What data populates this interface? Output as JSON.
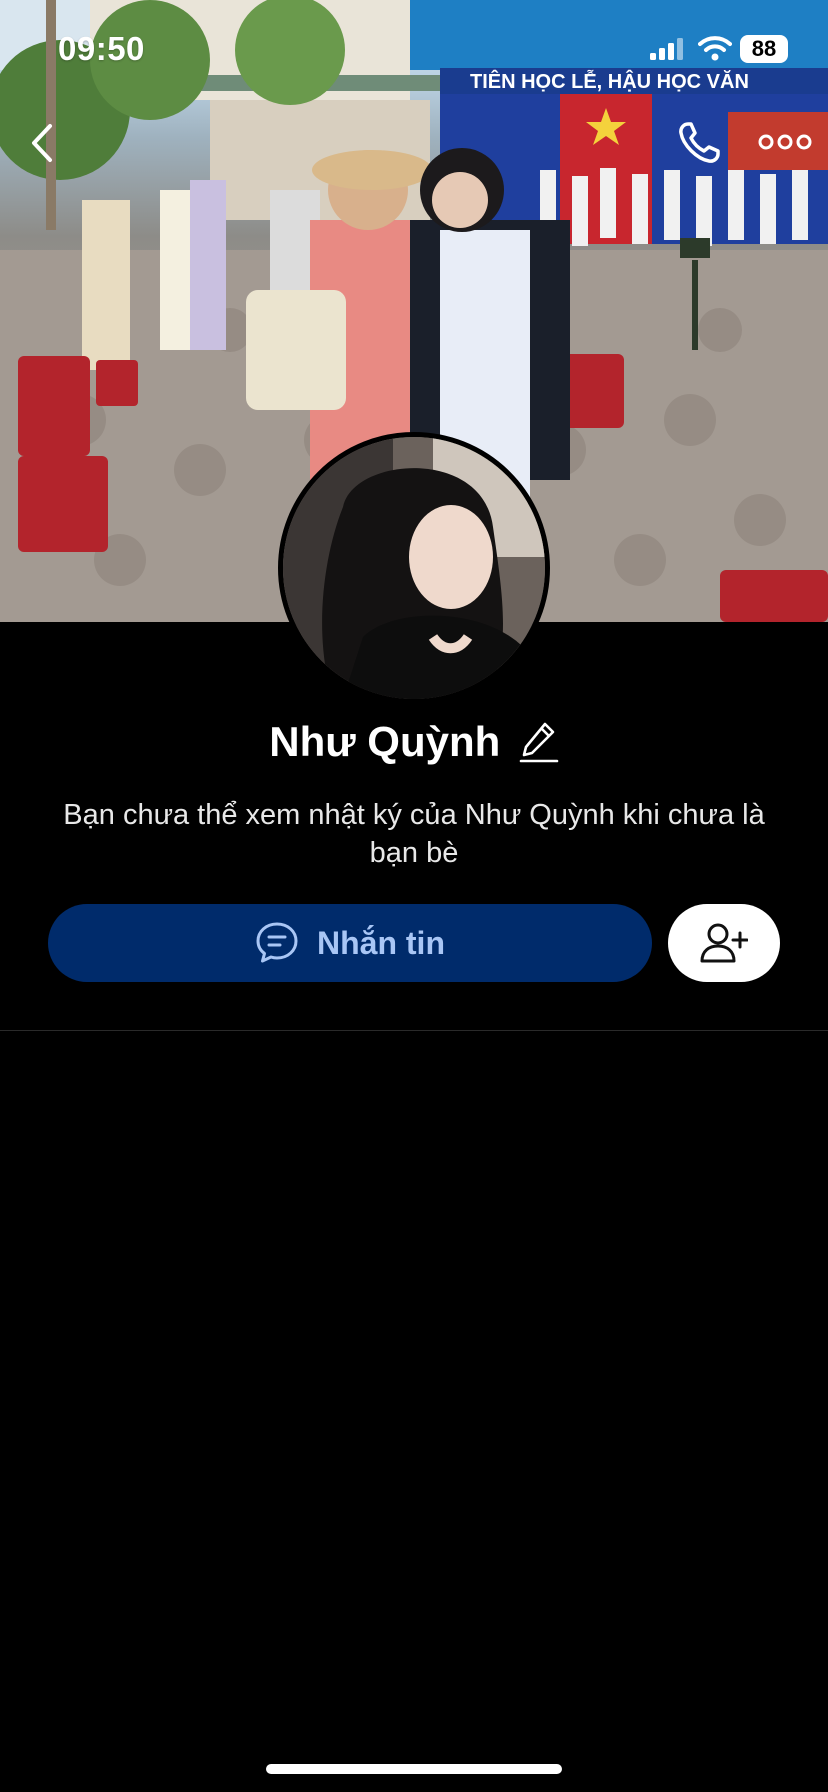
{
  "status_bar": {
    "time": "09:50",
    "battery": "88"
  },
  "nav": {
    "back_icon": "chevron-left-icon",
    "call_icon": "phone-icon",
    "more_icon": "more-dots-icon"
  },
  "cover": {
    "banner_text": "TIÊN HỌC LỄ, HẬU HỌC VĂN"
  },
  "profile": {
    "name": "Như Quỳnh",
    "edit_icon": "pencil-icon",
    "privacy_message": "Bạn chưa thể xem nhật ký của Như Quỳnh khi chưa là bạn bè"
  },
  "actions": {
    "message_label": "Nhắn tin",
    "message_icon": "chat-bubble-icon",
    "add_friend_icon": "add-user-icon"
  },
  "colors": {
    "background": "#000000",
    "message_button_bg": "#002b6b",
    "message_button_text": "#a9c6f5",
    "add_friend_bg": "#ffffff"
  }
}
